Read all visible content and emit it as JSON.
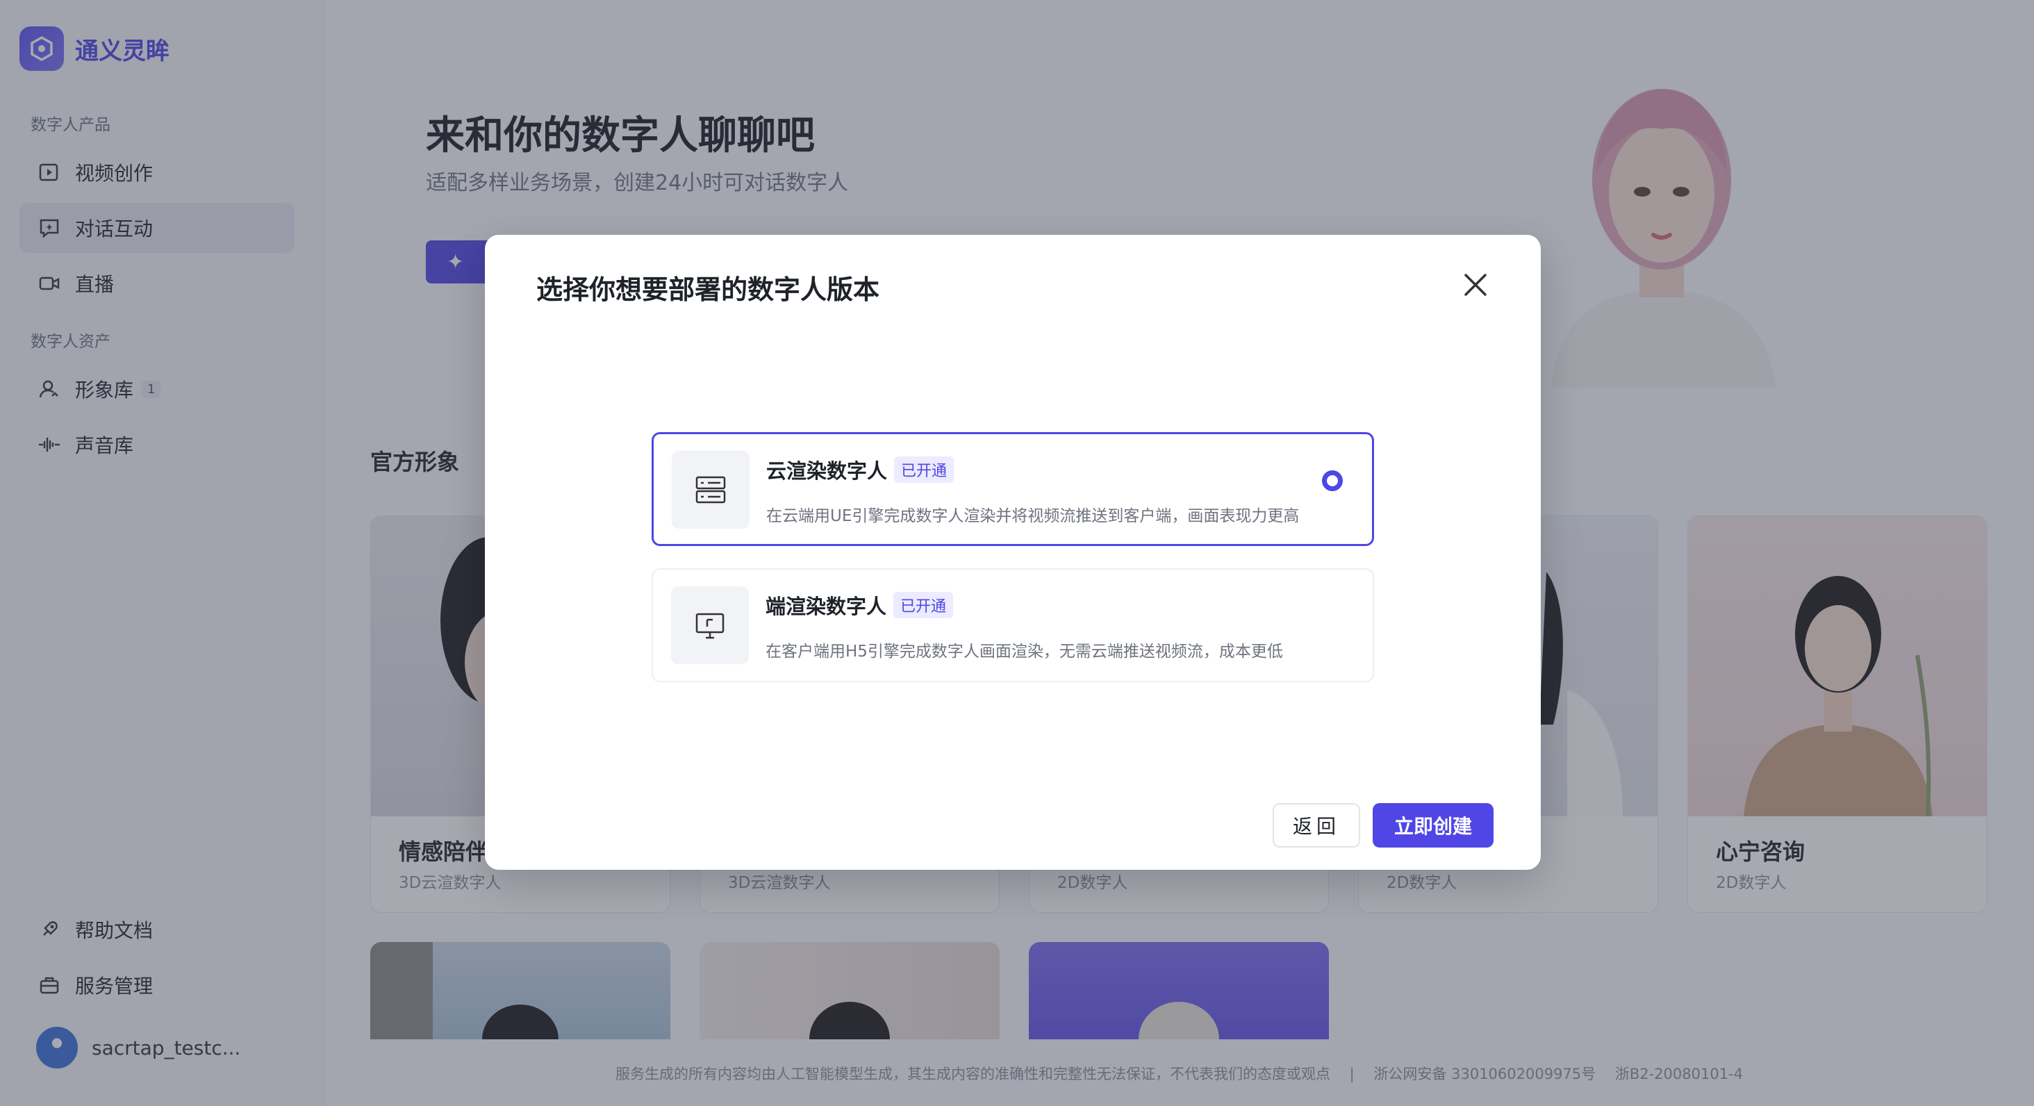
{
  "app": {
    "name": "通义灵眸"
  },
  "sidebar": {
    "section_products": "数字人产品",
    "items_products": [
      {
        "label": "视频创作"
      },
      {
        "label": "对话互动"
      },
      {
        "label": "直播"
      }
    ],
    "section_assets": "数字人资产",
    "items_assets": [
      {
        "label": "形象库",
        "badge": "1"
      },
      {
        "label": "声音库"
      }
    ],
    "items_bottom": [
      {
        "label": "帮助文档"
      },
      {
        "label": "服务管理"
      }
    ],
    "user": {
      "name": "sacrtap_testc..."
    }
  },
  "main": {
    "hero_title": "来和你的数字人聊聊吧",
    "hero_subtitle": "适配多样业务场景，创建24小时可对话数字人",
    "section_title": "官方形象",
    "cards": [
      {
        "name": "情感陪伴",
        "type": "3D云渲数字人"
      },
      {
        "name": "",
        "type": "3D云渲数字人"
      },
      {
        "name": "",
        "type": "2D数字人"
      },
      {
        "name": "",
        "type": "2D数字人"
      },
      {
        "name": "心宁咨询",
        "type": "2D数字人"
      }
    ],
    "footer": "服务生成的所有内容均由人工智能模型生成，其生成内容的准确性和完整性无法保证，不代表我们的态度或观点 　|　 浙公网安备 33010602009975号 　浙B2-20080101-4"
  },
  "modal": {
    "title": "选择你想要部署的数字人版本",
    "options": [
      {
        "title": "云渲染数字人",
        "tag": "已开通",
        "desc": "在云端用UE引擎完成数字人渲染并将视频流推送到客户端，画面表现力更高",
        "selected": true
      },
      {
        "title": "端渲染数字人",
        "tag": "已开通",
        "desc": "在客户端用H5引擎完成数字人画面渲染，无需云端推送视频流，成本更低",
        "selected": false
      }
    ],
    "back_label": "返回",
    "create_label": "立即创建"
  },
  "colors": {
    "accent": "#4f46e5",
    "overlay": "#3c4052"
  }
}
